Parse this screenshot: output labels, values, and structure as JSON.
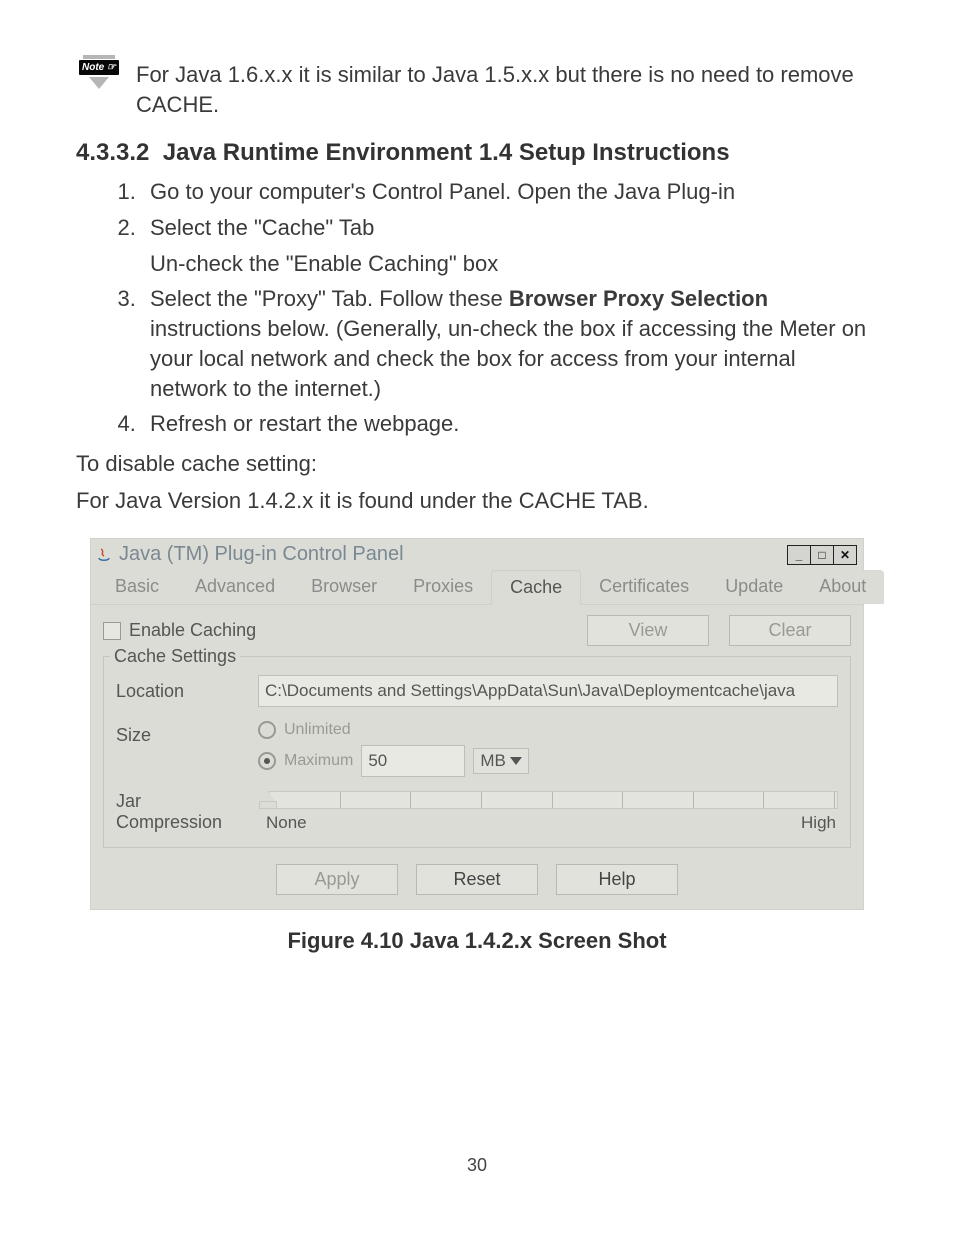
{
  "note": {
    "icon_label": "Note ☞",
    "text": "For Java 1.6.x.x it is similar to Java 1.5.x.x but there is no need to remove CACHE."
  },
  "section": {
    "number": "4.3.3.2",
    "title": "Java Runtime Environment 1.4 Setup Instructions"
  },
  "steps": {
    "s1": "Go to your computer's Control Panel. Open the Java Plug-in",
    "s2a": "Select the \"Cache\" Tab",
    "s2b": "Un-check the \"Enable Caching\" box",
    "s3a": "Select the \"Proxy\" Tab.  Follow these ",
    "s3bold": "Browser Proxy Selection",
    "s3b": " instructions below. (Generally, un-check the box if accessing the Meter on your local network and check the box for access from your internal network to the internet.)",
    "s4": "Refresh or restart the webpage."
  },
  "body": {
    "p1": "To disable cache setting:",
    "p2": "For Java Version 1.4.2.x it is found under the CACHE TAB."
  },
  "window": {
    "title": "Java (TM) Plug-in Control Panel",
    "tabs": {
      "basic": "Basic",
      "advanced": "Advanced",
      "browser": "Browser",
      "proxies": "Proxies",
      "cache": "Cache",
      "certificates": "Certificates",
      "update": "Update",
      "about": "About"
    },
    "enable_caching": "Enable Caching",
    "view": "View",
    "clear": "Clear",
    "fieldset_legend": "Cache Settings",
    "location_label": "Location",
    "location_value": "C:\\Documents and Settings\\AppData\\Sun\\Java\\Deploymentcache\\java",
    "size_label": "Size",
    "size_unlimited": "Unlimited",
    "size_maximum": "Maximum",
    "size_value": "50",
    "size_unit": "MB",
    "jar_label": "Jar Compression",
    "slider_none": "None",
    "slider_high": "High",
    "apply": "Apply",
    "reset": "Reset",
    "help": "Help"
  },
  "caption": "Figure 4.10  Java 1.4.2.x Screen Shot",
  "page_number": "30"
}
